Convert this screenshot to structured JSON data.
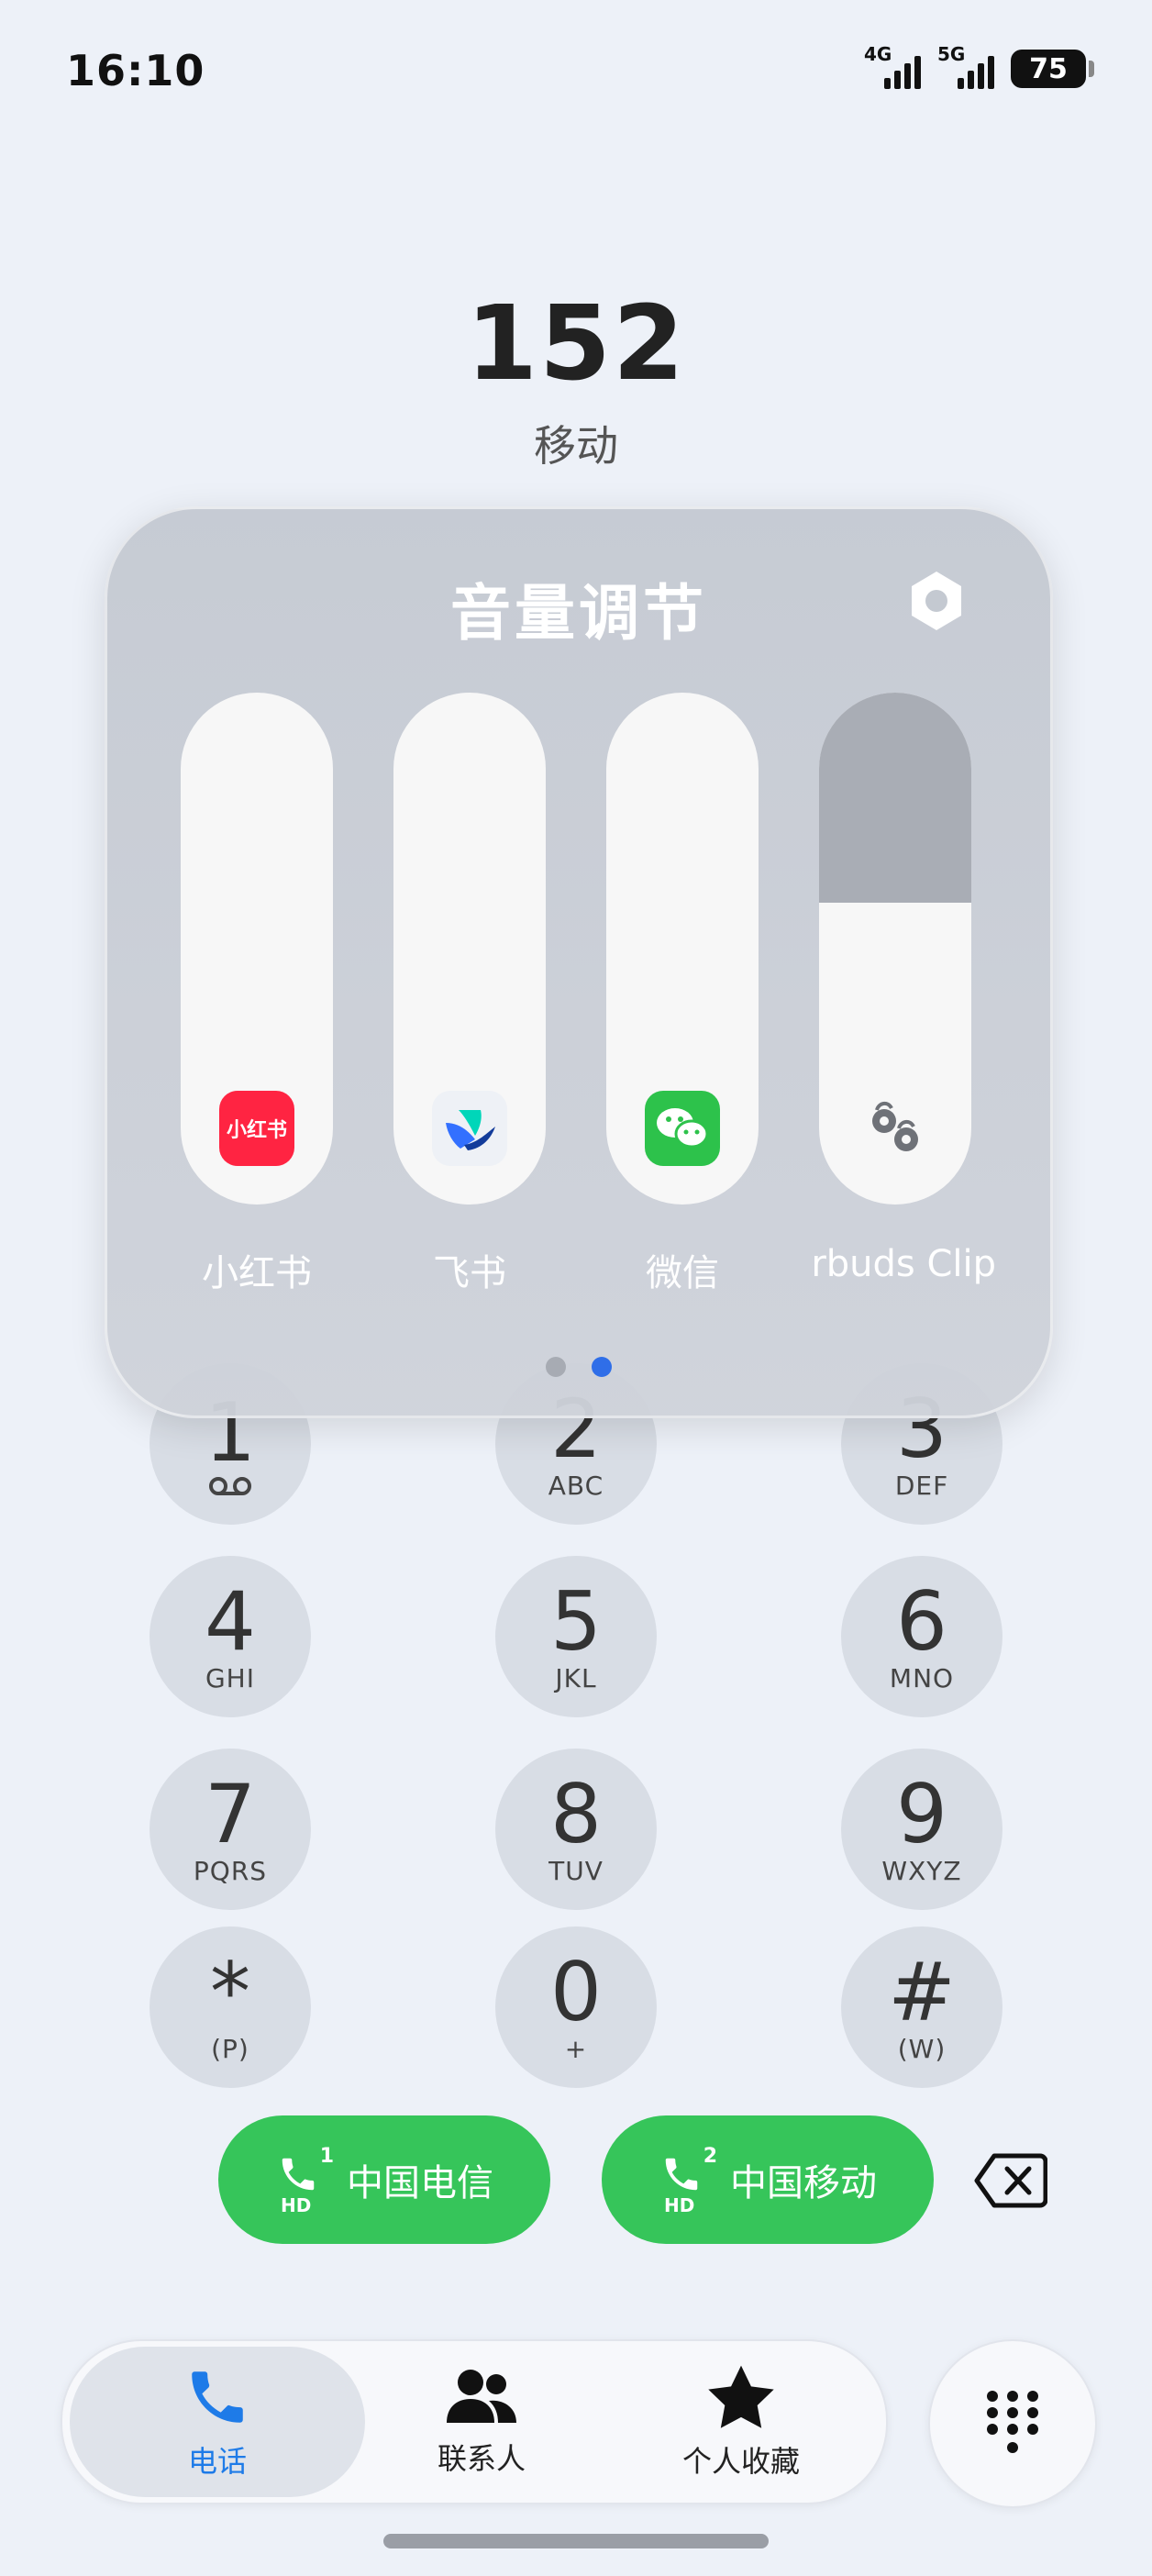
{
  "status_bar": {
    "time": "16:10",
    "sim1_network": "4G",
    "sim2_network": "5G",
    "battery": "75"
  },
  "dialer": {
    "number": "152",
    "carrier_hint": "移动"
  },
  "volume_panel": {
    "title": "音量调节",
    "sliders": [
      {
        "label": "小红书",
        "icon": "xiaohongshu-icon",
        "icon_text": "小红书",
        "level": 1.0
      },
      {
        "label": "飞书",
        "icon": "feishu-icon",
        "level": 1.0
      },
      {
        "label": "微信",
        "icon": "wechat-icon",
        "level": 1.0
      },
      {
        "label": "rbuds Clip",
        "icon": "earbuds-icon",
        "level": 0.59
      }
    ],
    "page_count": 2,
    "current_page": 2
  },
  "keypad": {
    "keys": [
      {
        "digit": "1",
        "letters": ""
      },
      {
        "digit": "2",
        "letters": "ABC"
      },
      {
        "digit": "3",
        "letters": "DEF"
      },
      {
        "digit": "4",
        "letters": "GHI"
      },
      {
        "digit": "5",
        "letters": "JKL"
      },
      {
        "digit": "6",
        "letters": "MNO"
      },
      {
        "digit": "7",
        "letters": "PQRS"
      },
      {
        "digit": "8",
        "letters": "TUV"
      },
      {
        "digit": "9",
        "letters": "WXYZ"
      },
      {
        "digit": "*",
        "letters": "(P)"
      },
      {
        "digit": "0",
        "letters": "+"
      },
      {
        "digit": "#",
        "letters": "(W)"
      }
    ]
  },
  "call_buttons": [
    {
      "sim": "1",
      "hd": "HD",
      "label": "中国电信"
    },
    {
      "sim": "2",
      "hd": "HD",
      "label": "中国移动"
    }
  ],
  "bottom_nav": {
    "phone": "电话",
    "contacts": "联系人",
    "favorites": "个人收藏"
  },
  "colors": {
    "background": "#edf1f8",
    "call_green": "#36c55a",
    "accent_blue": "#1e7be8",
    "key_gray": "#d8dde5"
  }
}
